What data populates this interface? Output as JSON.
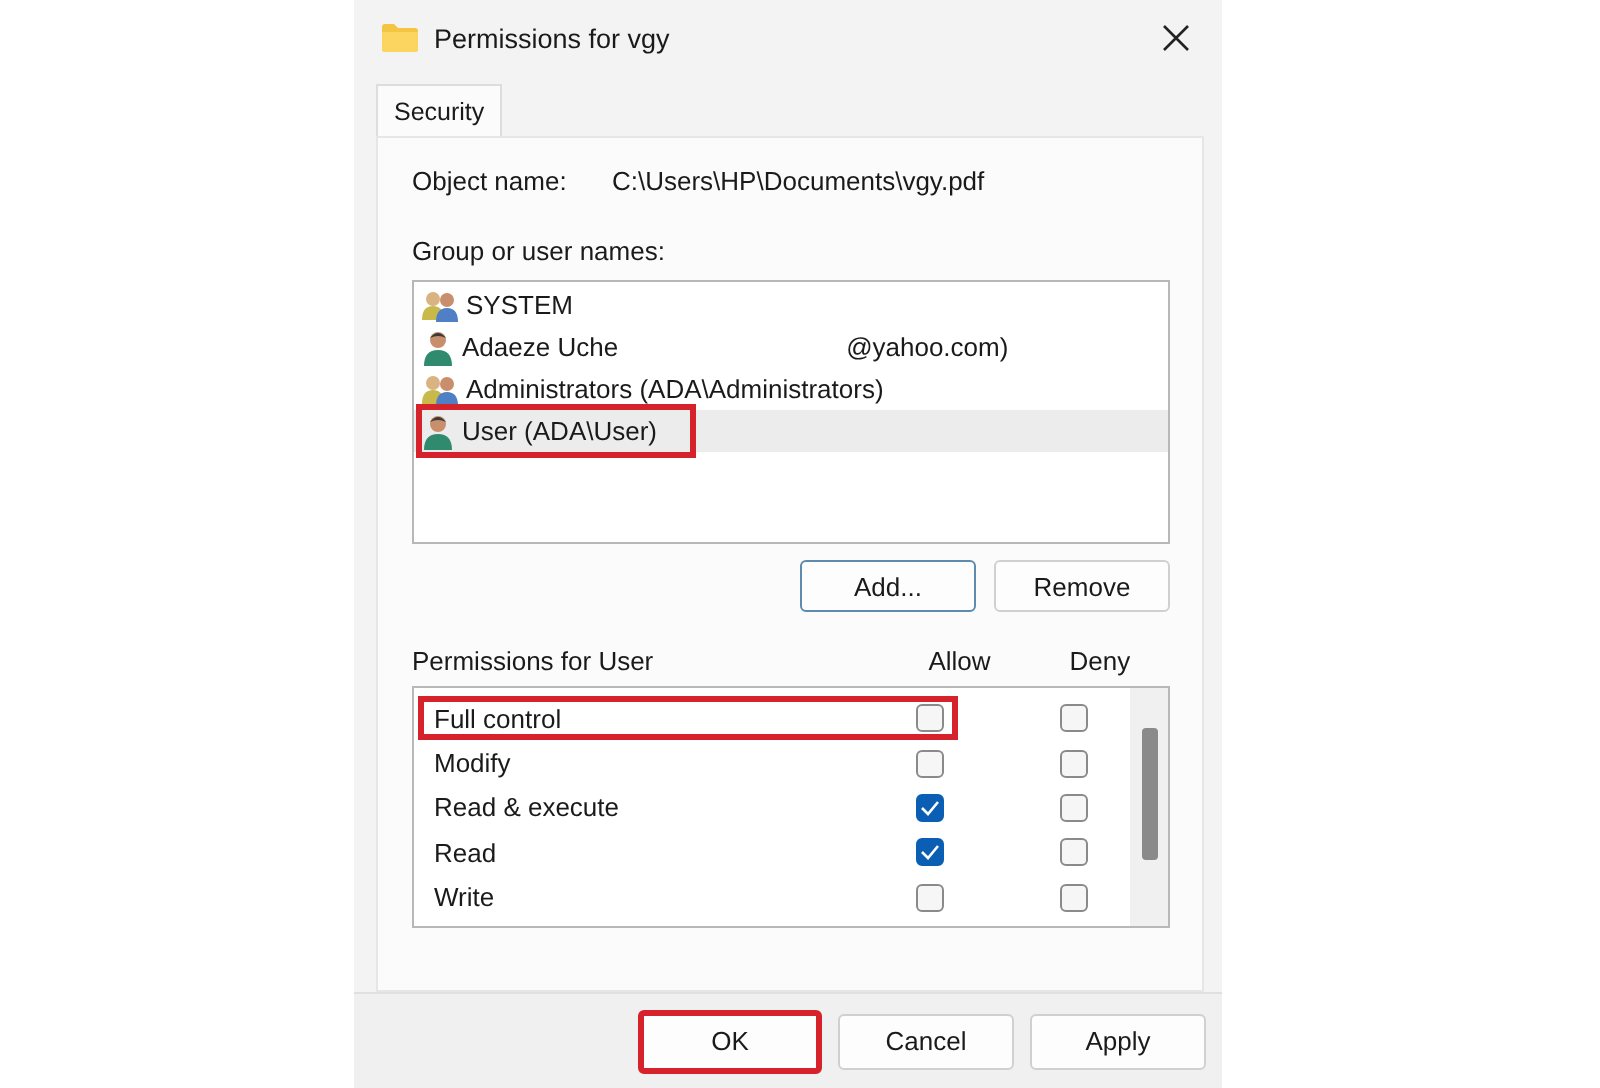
{
  "window": {
    "title": "Permissions for vgy"
  },
  "tabs": [
    {
      "label": "Security",
      "selected": true
    }
  ],
  "object_name": {
    "label": "Object name:",
    "value": "C:\\Users\\HP\\Documents\\vgy.pdf"
  },
  "group_list": {
    "label": "Group or user names:",
    "items": [
      {
        "kind": "group",
        "label": "SYSTEM",
        "selected": false,
        "highlighted": false
      },
      {
        "kind": "user",
        "label": "Adaeze Uche",
        "suffix": "@yahoo.com)",
        "selected": false,
        "highlighted": false
      },
      {
        "kind": "group",
        "label": "Administrators (ADA\\Administrators)",
        "selected": false,
        "highlighted": false
      },
      {
        "kind": "user",
        "label": "User (ADA\\User)",
        "selected": true,
        "highlighted": true
      }
    ]
  },
  "list_buttons": [
    "Add...",
    "Remove"
  ],
  "permissions": {
    "label": "Permissions for User",
    "allow_header": "Allow",
    "deny_header": "Deny",
    "rows": [
      {
        "label": "Full control",
        "allow": false,
        "deny": false,
        "highlighted": true
      },
      {
        "label": "Modify",
        "allow": false,
        "deny": false,
        "highlighted": false
      },
      {
        "label": "Read & execute",
        "allow": true,
        "deny": false,
        "highlighted": false
      },
      {
        "label": "Read",
        "allow": true,
        "deny": false,
        "highlighted": false
      },
      {
        "label": "Write",
        "allow": false,
        "deny": false,
        "highlighted": false
      }
    ]
  },
  "buttons": [
    {
      "label": "OK",
      "highlighted": true
    },
    {
      "label": "Cancel",
      "highlighted": false
    },
    {
      "label": "Apply",
      "highlighted": false
    }
  ]
}
